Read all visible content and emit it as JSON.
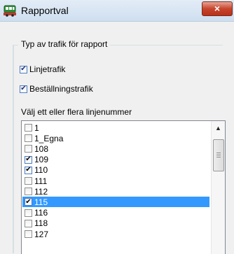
{
  "window": {
    "title": "Rapportval",
    "close_icon": "×"
  },
  "traffic_group": {
    "legend": "Typ av trafik för rapport",
    "options": [
      {
        "label": "Linjetrafik",
        "checked": true
      },
      {
        "label": "Beställningstrafik",
        "checked": true
      }
    ]
  },
  "line_list": {
    "label": "Välj ett eller flera linjenummer",
    "items": [
      {
        "label": "1",
        "checked": false,
        "selected": false
      },
      {
        "label": "1_Egna",
        "checked": false,
        "selected": false
      },
      {
        "label": "108",
        "checked": false,
        "selected": false
      },
      {
        "label": "109",
        "checked": true,
        "selected": false
      },
      {
        "label": "110",
        "checked": true,
        "selected": false
      },
      {
        "label": "111",
        "checked": false,
        "selected": false
      },
      {
        "label": "112",
        "checked": false,
        "selected": false
      },
      {
        "label": "115",
        "checked": true,
        "selected": true
      },
      {
        "label": "116",
        "checked": false,
        "selected": false
      },
      {
        "label": "118",
        "checked": false,
        "selected": false
      },
      {
        "label": "127",
        "checked": false,
        "selected": false
      }
    ],
    "scroll_up_icon": "▲"
  },
  "colors": {
    "selection": "#3399ff",
    "close": "#c7452d"
  }
}
